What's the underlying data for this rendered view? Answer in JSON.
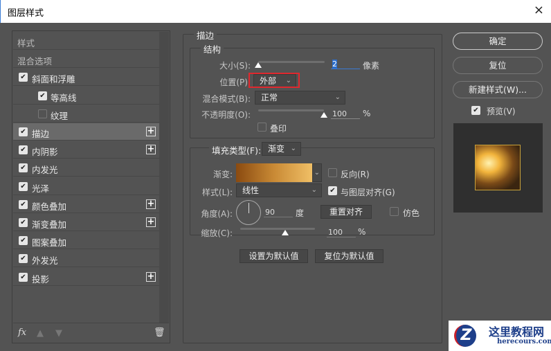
{
  "window": {
    "title": "图层样式",
    "close_icon": "×"
  },
  "sidebar": {
    "items": [
      {
        "label": "样式",
        "checkbox": null,
        "plus": false
      },
      {
        "label": "混合选项",
        "checkbox": null,
        "plus": false
      },
      {
        "label": "斜面和浮雕",
        "checkbox": true,
        "plus": false
      },
      {
        "label": "等高线",
        "checkbox": true,
        "plus": false,
        "indent": true
      },
      {
        "label": "纹理",
        "checkbox": false,
        "plus": false,
        "indent": true
      },
      {
        "label": "描边",
        "checkbox": true,
        "plus": true,
        "selected": true
      },
      {
        "label": "内阴影",
        "checkbox": true,
        "plus": true
      },
      {
        "label": "内发光",
        "checkbox": true,
        "plus": false
      },
      {
        "label": "光泽",
        "checkbox": true,
        "plus": false
      },
      {
        "label": "颜色叠加",
        "checkbox": true,
        "plus": true
      },
      {
        "label": "渐变叠加",
        "checkbox": true,
        "plus": true
      },
      {
        "label": "图案叠加",
        "checkbox": true,
        "plus": false
      },
      {
        "label": "外发光",
        "checkbox": true,
        "plus": false
      },
      {
        "label": "投影",
        "checkbox": true,
        "plus": true
      }
    ],
    "fx_label": "fx"
  },
  "stroke": {
    "title": "描边",
    "structure_title": "结构",
    "size_label": "大小(S):",
    "size_value": "2",
    "size_unit": "像素",
    "size_fraction": 0.0,
    "position_label": "位置(P):",
    "position_value": "外部",
    "blend_label": "混合模式(B):",
    "blend_value": "正常",
    "opacity_label": "不透明度(O):",
    "opacity_value": "100",
    "opacity_unit": "%",
    "opacity_fraction": 1.0,
    "overprint_label": "叠印",
    "overprint_checked": false,
    "fill_type_label": "填充类型(F):",
    "fill_type_value": "渐变",
    "gradient_label": "渐变:",
    "gradient_colors": [
      "#8a4a10",
      "#c98a35",
      "#f0bf66"
    ],
    "reverse_label": "反向(R)",
    "reverse_checked": false,
    "style_label": "样式(L):",
    "style_value": "线性",
    "align_label": "与图层对齐(G)",
    "align_checked": true,
    "angle_label": "角度(A):",
    "angle_value": "90",
    "angle_unit": "度",
    "reset_align_label": "重置对齐",
    "dither_label": "仿色",
    "dither_checked": false,
    "scale_label": "缩放(C):",
    "scale_value": "100",
    "scale_unit": "%",
    "scale_fraction": 0.5,
    "make_default_label": "设置为默认值",
    "reset_default_label": "复位为默认值"
  },
  "actions": {
    "ok": "确定",
    "reset": "复位",
    "new_style": "新建样式(W)...",
    "preview_label": "预览(V)",
    "preview_checked": true
  },
  "watermark": {
    "title": "这里教程网",
    "url": "herecours.com"
  },
  "accent": "#e0282e"
}
